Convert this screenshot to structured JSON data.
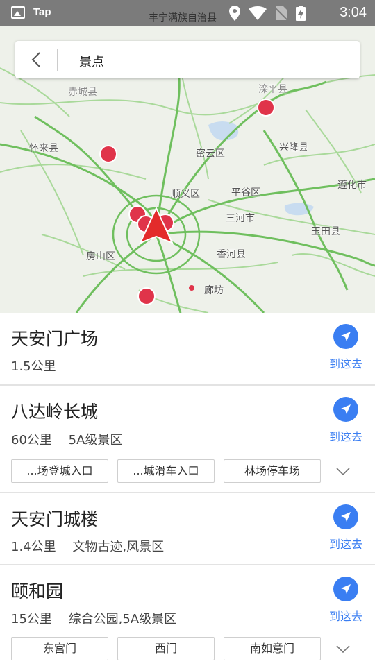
{
  "status_bar": {
    "app_name": "Tap",
    "location_text": "丰宁满族自治县",
    "time": "3:04",
    "icons": [
      "image-icon",
      "location-icon",
      "wifi-icon",
      "no-sim-icon",
      "battery-charging-icon"
    ]
  },
  "search": {
    "query": "景点"
  },
  "map": {
    "labels": [
      {
        "text": "怀来县"
      },
      {
        "text": "密云区"
      },
      {
        "text": "兴隆县"
      },
      {
        "text": "顺义区"
      },
      {
        "text": "平谷区"
      },
      {
        "text": "遵化市"
      },
      {
        "text": "三河市"
      },
      {
        "text": "玉田县"
      },
      {
        "text": "房山区"
      },
      {
        "text": "香河县"
      },
      {
        "text": "廊坊"
      },
      {
        "text": "滦平县"
      },
      {
        "text": "赤城县"
      }
    ],
    "colors": {
      "road": "#6fbf5e",
      "road_light": "#a9d99a",
      "land": "#eef1ea",
      "poi_marker": "#e0344a",
      "location_arrow": "#e32b2b"
    }
  },
  "results": [
    {
      "title": "天安门广场",
      "distance": "1.5公里",
      "category": "",
      "go_label": "到这去",
      "chips": []
    },
    {
      "title": "八达岭长城",
      "distance": "60公里",
      "category": "5A级景区",
      "go_label": "到这去",
      "chips": [
        "...场登城入口",
        "...城滑车入口",
        "林场停车场"
      ]
    },
    {
      "title": "天安门城楼",
      "distance": "1.4公里",
      "category": "文物古迹,风景区",
      "go_label": "到这去",
      "chips": []
    },
    {
      "title": "颐和园",
      "distance": "15公里",
      "category": "综合公园,5A级景区",
      "go_label": "到这去",
      "chips": [
        "东宫门",
        "西门",
        "南如意门"
      ]
    }
  ]
}
